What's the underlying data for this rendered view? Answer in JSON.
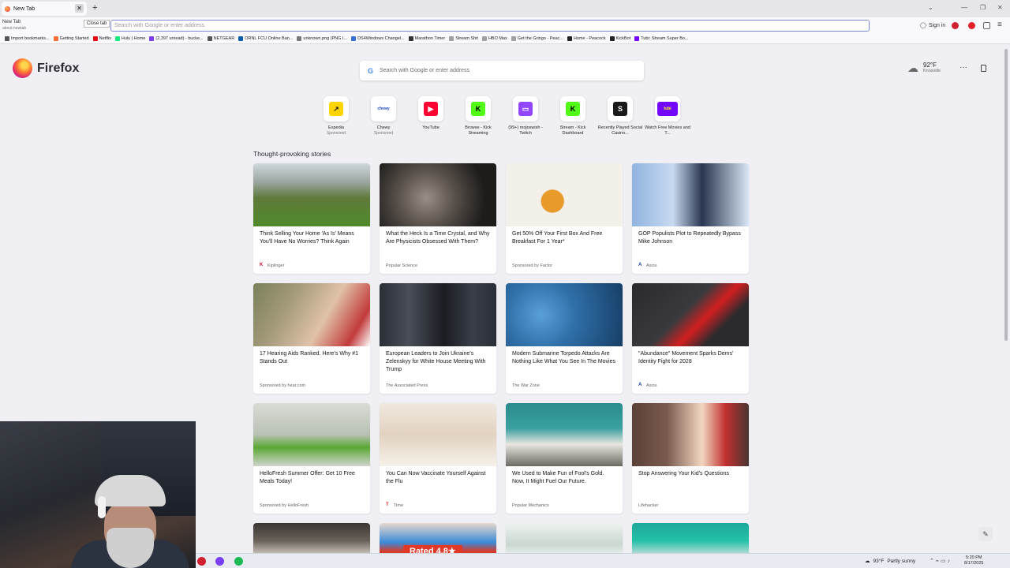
{
  "tab": {
    "title": "New Tab",
    "close_glyph": "✕"
  },
  "tab_hover": {
    "title": "New Tab",
    "url": "about:newtab"
  },
  "tooltip": "Close tab",
  "window": {
    "newtab": "+",
    "list": "⌄",
    "minimize": "—",
    "restore": "❐",
    "close": "✕"
  },
  "urlbar": {
    "placeholder": "Search with Google or enter address"
  },
  "toolbar": {
    "signin": "Sign in",
    "menu": "≡"
  },
  "bookmarks": [
    {
      "label": "Import bookmarks...",
      "color": "#555555"
    },
    {
      "label": "Getting Started",
      "color": "#ff7139"
    },
    {
      "label": "Netflix",
      "color": "#e50914"
    },
    {
      "label": "Hulu | Home",
      "color": "#1ce783"
    },
    {
      "label": "(2,397 unread) - bucke...",
      "color": "#7b3ff2"
    },
    {
      "label": "NETGEAR",
      "color": "#555555"
    },
    {
      "label": "ORNL FCU Online Ban...",
      "color": "#0a5cab"
    },
    {
      "label": "unknown.png (PNG I...",
      "color": "#777777"
    },
    {
      "label": "DS4Windows Changel...",
      "color": "#3b6fd6"
    },
    {
      "label": "Marathon Timer",
      "color": "#333333"
    },
    {
      "label": "Stream Shit",
      "color": "#a0a0a0"
    },
    {
      "label": "HBO Max",
      "color": "#a0a0a0"
    },
    {
      "label": "Get the Gringo - Peac...",
      "color": "#a0a0a0"
    },
    {
      "label": "Home - Peacock",
      "color": "#222222"
    },
    {
      "label": "KickBot",
      "color": "#222222"
    },
    {
      "label": "Tubi: Stream Super Bo...",
      "color": "#7408ff"
    }
  ],
  "brand": {
    "name": "Firefox"
  },
  "search": {
    "g": "G",
    "placeholder": "Search with Google or enter address"
  },
  "weather": {
    "icon": "☁",
    "temp": "92°F",
    "city": "Knoxville"
  },
  "page_menu": "···",
  "shortcuts": [
    {
      "label": "Expedia",
      "sponsored": "Sponsored",
      "glyph": "↗",
      "bg": "#ffd400",
      "fg": "#1a1a1a"
    },
    {
      "label": "Chewy",
      "sponsored": "Sponsored",
      "glyph": "chewy",
      "bg": "#ffffff",
      "fg": "#1c49c2"
    },
    {
      "label": "YouTube",
      "sponsored": "",
      "glyph": "▶",
      "bg": "#ff0033",
      "fg": "#ffffff"
    },
    {
      "label": "Browse - Kick Streaming",
      "sponsored": "",
      "glyph": "K",
      "bg": "#53fc18",
      "fg": "#000000"
    },
    {
      "label": "(99+) mojoswish - Twitch",
      "sponsored": "",
      "glyph": "▭",
      "bg": "#9146ff",
      "fg": "#ffffff"
    },
    {
      "label": "Stream - Kick Dashboard",
      "sponsored": "",
      "glyph": "K",
      "bg": "#53fc18",
      "fg": "#000000"
    },
    {
      "label": "Recently Played Social Casino...",
      "sponsored": "",
      "glyph": "S",
      "bg": "#1a1a1a",
      "fg": "#ffffff"
    },
    {
      "label": "Watch Free Movies and T...",
      "sponsored": "",
      "glyph": "tubi",
      "bg": "#7408ff",
      "fg": "#ffff00"
    }
  ],
  "section_title": "Thought-provoking stories",
  "stories": [
    {
      "title": "Think Selling Your Home 'As Is' Means You'll Have No Worries? Think Again",
      "source": "Kiplinger",
      "src_glyph": "K",
      "src_color": "#c8102e",
      "img": "linear-gradient(180deg,#cfd8dc 0%,#9aa5a0 30%,#5f7a3a 55%,#4f8a2a 100%)"
    },
    {
      "title": "What the Heck Is a Time Crystal, and Why Are Physicists Obsessed With Them?",
      "source": "Popular Science",
      "src_glyph": "",
      "src_color": "#666666",
      "img": "radial-gradient(circle at 40% 55%,#9a8f86 0%,#5a524c 35%,#1e1c1b 75%)"
    },
    {
      "title": "Get 50% Off Your First Box And Free Breakfast For 1 Year*",
      "source": "Sponsored by Factor",
      "src_glyph": "",
      "src_color": "#666666",
      "img": "radial-gradient(circle at 40% 60%,#e89a2a 0 14%,#f3f0ea 15% 100%)"
    },
    {
      "title": "GOP Populists Plot to Repeatedly Bypass Mike Johnson",
      "source": "Axios",
      "src_glyph": "A",
      "src_color": "#1c3d8c",
      "img": "linear-gradient(90deg,#8fb4e0 0%,#c8daf0 35%,#2a3550 60%,#d9e6f5 100%)"
    },
    {
      "title": "17 Hearing Aids Ranked. Here's Why #1 Stands Out",
      "source": "Sponsored by hear.com",
      "src_glyph": "",
      "src_color": "#666666",
      "img": "linear-gradient(120deg,#7a7f5a 0%,#a39a7a 30%,#e0c2a8 60%,#c23b3b 85%,#ffffff 100%)"
    },
    {
      "title": "European Leaders to Join Ukraine's Zelenskyy for White House Meeting With Trump",
      "source": "The Associated Press",
      "src_glyph": "",
      "src_color": "#666666",
      "img": "linear-gradient(90deg,#2a2e36 0%,#4a4e58 25%,#1a1c22 55%,#3a3e48 80%,#2a2e36 100%)"
    },
    {
      "title": "Modern Submarine Torpedo Attacks Are Nothing Like What You See In The Movies",
      "source": "The War Zone",
      "src_glyph": "",
      "src_color": "#666666",
      "img": "radial-gradient(circle at 30% 50%,#5aa0d8 0%,#2f6fa8 40%,#173e66 100%)"
    },
    {
      "title": "\"Abundance\" Movement Sparks Dems' Identity Fight for 2028",
      "source": "Axios",
      "src_glyph": "A",
      "src_color": "#1c3d8c",
      "img": "linear-gradient(135deg,#2a2a2e 0%,#3a3a3e 45%,#d01f1f 60%,#2a2a2e 75%)"
    },
    {
      "title": "HelloFresh Summer Offer: Get 10 Free Meals Today!",
      "source": "Sponsored by HelloFresh",
      "src_glyph": "",
      "src_color": "#666666",
      "img": "linear-gradient(180deg,#d8dcd6 0%,#b9c0b4 50%,#5aa834 70%,#d0d4ce 100%)"
    },
    {
      "title": "You Can Now Vaccinate Yourself Against the Flu",
      "source": "Time",
      "src_glyph": "T",
      "src_color": "#e0302e",
      "img": "linear-gradient(180deg,#efe8de 0%,#e2d2c0 50%,#f6f1ea 100%)"
    },
    {
      "title": "We Used to Make Fun of Fool's Gold. Now, It Might Fuel Our Future.",
      "source": "Popular Mechanics",
      "src_glyph": "",
      "src_color": "#666666",
      "img": "linear-gradient(180deg,#2a8c8c 0%,#3aa0a0 40%,#e8e6e0 65%,#6a6a62 100%)"
    },
    {
      "title": "Stop Answering Your Kid's Questions",
      "source": "Lifehacker",
      "src_glyph": "",
      "src_color": "#666666",
      "img": "linear-gradient(90deg,#5a4038 0%,#7a5a4e 30%,#f2d7c0 60%,#c23030 80%,#4a3530 100%)"
    }
  ],
  "stories_partial": [
    {
      "img": "linear-gradient(180deg,#3a3632 0%,#6a625a 50%,#e8e4de 100%)",
      "badge": ""
    },
    {
      "img": "linear-gradient(180deg,#e8d8cc 0%,#3a8ad8 55%,#d83a2a 80%)",
      "badge": "Rated 4.8★"
    },
    {
      "img": "linear-gradient(180deg,#eef2ef 0%,#c9d8d0 60%,#f4f6f4 100%)",
      "badge": ""
    },
    {
      "img": "linear-gradient(180deg,#1ea89a 0%,#24c0a8 50%,#e8e8e8 100%)",
      "badge": ""
    }
  ],
  "taskbar": {
    "weather_icon": "☁",
    "weather_temp": "93°F",
    "weather_desc": "Partly sunny",
    "tray": "⌃ ⌁ ▭ ♪",
    "time": "5:20 PM",
    "date": "8/17/2025"
  },
  "edit_icon_glyph": "✎",
  "colors": {
    "accent": "#7a88d6",
    "page_bg": "#f0f0f4"
  }
}
